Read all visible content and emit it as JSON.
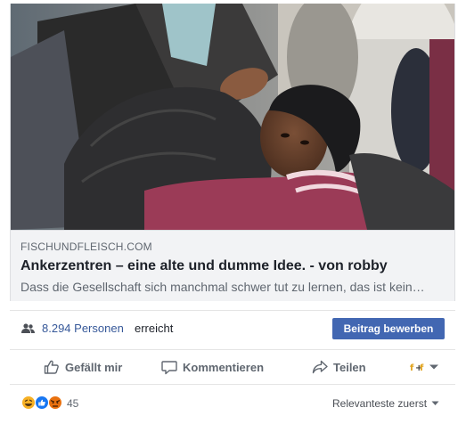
{
  "link_preview": {
    "image_icon": "photo-refugee-boy",
    "domain": "FISCHUNDFLEISCH.COM",
    "title": "Ankerzentren – eine alte und dumme Idee. - von robby",
    "description": "Dass die Gesellschaft sich manchmal schwer tut zu lernen, das ist kein…"
  },
  "reach": {
    "icon": "people-icon",
    "count_text": "8.294 Personen",
    "suffix_text": "erreicht",
    "promote_label": "Beitrag bewerben"
  },
  "actions": {
    "like_label": "Gefällt mir",
    "comment_label": "Kommentieren",
    "share_label": "Teilen"
  },
  "reactions": {
    "icons": [
      "haha-icon",
      "like-reaction-icon",
      "angry-icon"
    ],
    "count": "45",
    "sort_label": "Relevanteste zuerst"
  },
  "colors": {
    "link_blue": "#365899",
    "button_blue": "#4267b2",
    "secondary_text": "#606770",
    "preview_bg": "#f2f3f5"
  }
}
